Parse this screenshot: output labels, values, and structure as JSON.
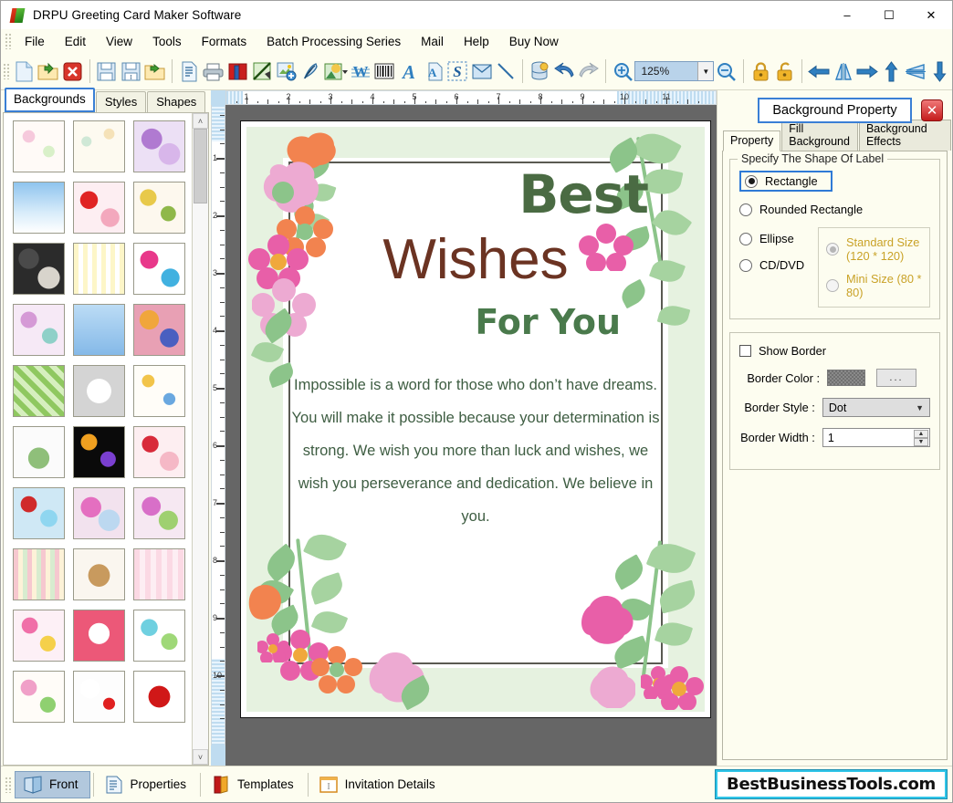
{
  "window": {
    "title": "DRPU Greeting Card Maker Software",
    "app_icon": "drpu-logo-icon",
    "minimize": "–",
    "maximize": "☐",
    "close": "✕"
  },
  "menubar": {
    "items": [
      {
        "label": "File"
      },
      {
        "label": "Edit"
      },
      {
        "label": "View"
      },
      {
        "label": "Tools"
      },
      {
        "label": "Formats"
      },
      {
        "label": "Batch Processing Series"
      },
      {
        "label": "Mail"
      },
      {
        "label": "Help"
      },
      {
        "label": "Buy Now"
      }
    ]
  },
  "toolbar": {
    "zoom_value": "125%",
    "buttons": [
      {
        "name": "new-document-icon"
      },
      {
        "name": "open-folder-icon"
      },
      {
        "name": "close-document-icon"
      },
      {
        "name": "save-icon"
      },
      {
        "name": "save-as-icon"
      },
      {
        "name": "export-folder-icon"
      },
      {
        "name": "page-properties-icon"
      },
      {
        "name": "print-icon"
      },
      {
        "name": "card-layers-icon"
      },
      {
        "name": "design-view-icon"
      },
      {
        "name": "insert-image-icon"
      },
      {
        "name": "pen-tool-icon"
      },
      {
        "name": "shape-fill-icon"
      },
      {
        "name": "watermark-icon"
      },
      {
        "name": "barcode-icon"
      },
      {
        "name": "text-tool-icon"
      },
      {
        "name": "text-area-icon"
      },
      {
        "name": "signature-icon"
      },
      {
        "name": "envelope-icon"
      },
      {
        "name": "line-tool-icon"
      },
      {
        "name": "database-icon"
      },
      {
        "name": "undo-icon"
      },
      {
        "name": "redo-icon"
      },
      {
        "name": "zoom-in-icon"
      },
      {
        "name": "zoom-out-icon"
      },
      {
        "name": "lock-icon"
      },
      {
        "name": "unlock-icon"
      },
      {
        "name": "align-left-icon"
      },
      {
        "name": "flip-horizontal-icon"
      },
      {
        "name": "align-right-icon"
      },
      {
        "name": "align-top-icon"
      },
      {
        "name": "flip-vertical-icon"
      },
      {
        "name": "align-bottom-icon"
      }
    ]
  },
  "left_panel": {
    "tabs": [
      {
        "label": "Backgrounds",
        "active": true
      },
      {
        "label": "Styles",
        "active": false
      },
      {
        "label": "Shapes",
        "active": false
      }
    ],
    "scroll_up": "˄",
    "scroll_down": "˅"
  },
  "rulers": {
    "horizontal_labels": [
      "1",
      "2",
      "3",
      "4",
      "5",
      "6",
      "7",
      "8",
      "9",
      "10",
      "11"
    ],
    "vertical_labels": [
      "1",
      "2",
      "3",
      "4",
      "5",
      "6",
      "7",
      "8",
      "9",
      "10"
    ]
  },
  "card": {
    "heading_1": "Best",
    "heading_2": "Wishes",
    "heading_3": "For You",
    "body": "Impossible is a word for those who don’t have dreams. You will make it possible because your determination is strong. We wish you more than luck and wishes, we wish you perseverance and dedication. We believe in you.",
    "colors": {
      "heading_1": "#4a6b43",
      "heading_2": "#6b3322",
      "heading_3": "#4a7a4c",
      "body": "#3e5d42",
      "frame_green": "#e6f2e0",
      "line": "#5a5a52"
    }
  },
  "right_panel": {
    "title": "Background Property",
    "close_label": "✕",
    "tabs": [
      {
        "label": "Property",
        "active": true
      },
      {
        "label": "Fill Background",
        "active": false
      },
      {
        "label": "Background Effects",
        "active": false
      }
    ],
    "shape_group": {
      "legend": "Specify The Shape Of Label",
      "options": [
        {
          "label": "Rectangle",
          "selected": true,
          "disabled": false,
          "highlighted": true
        },
        {
          "label": "Rounded Rectangle",
          "selected": false,
          "disabled": false,
          "highlighted": false
        },
        {
          "label": "Ellipse",
          "selected": false,
          "disabled": false,
          "highlighted": false
        },
        {
          "label": "CD/DVD",
          "selected": false,
          "disabled": false,
          "highlighted": false
        }
      ],
      "size_options": [
        {
          "label": "Standard Size (120 * 120)",
          "selected": true,
          "disabled": true
        },
        {
          "label": "Mini Size (80 * 80)",
          "selected": false,
          "disabled": true
        }
      ]
    },
    "border_group": {
      "show_border_label": "Show Border",
      "show_border_checked": false,
      "border_color_label": "Border Color :",
      "border_color_swatch": "#7d7d7d",
      "border_color_button": "...",
      "border_style_label": "Border Style :",
      "border_style_value": "Dot",
      "border_width_label": "Border Width :",
      "border_width_value": "1"
    }
  },
  "statusbar": {
    "items": [
      {
        "label": "Front",
        "icon": "front-card-icon",
        "active": true
      },
      {
        "label": "Properties",
        "icon": "properties-icon",
        "active": false
      },
      {
        "label": "Templates",
        "icon": "templates-icon",
        "active": false
      },
      {
        "label": "Invitation Details",
        "icon": "invitation-details-icon",
        "active": false
      }
    ],
    "brand": "BestBusinessTools.com"
  }
}
